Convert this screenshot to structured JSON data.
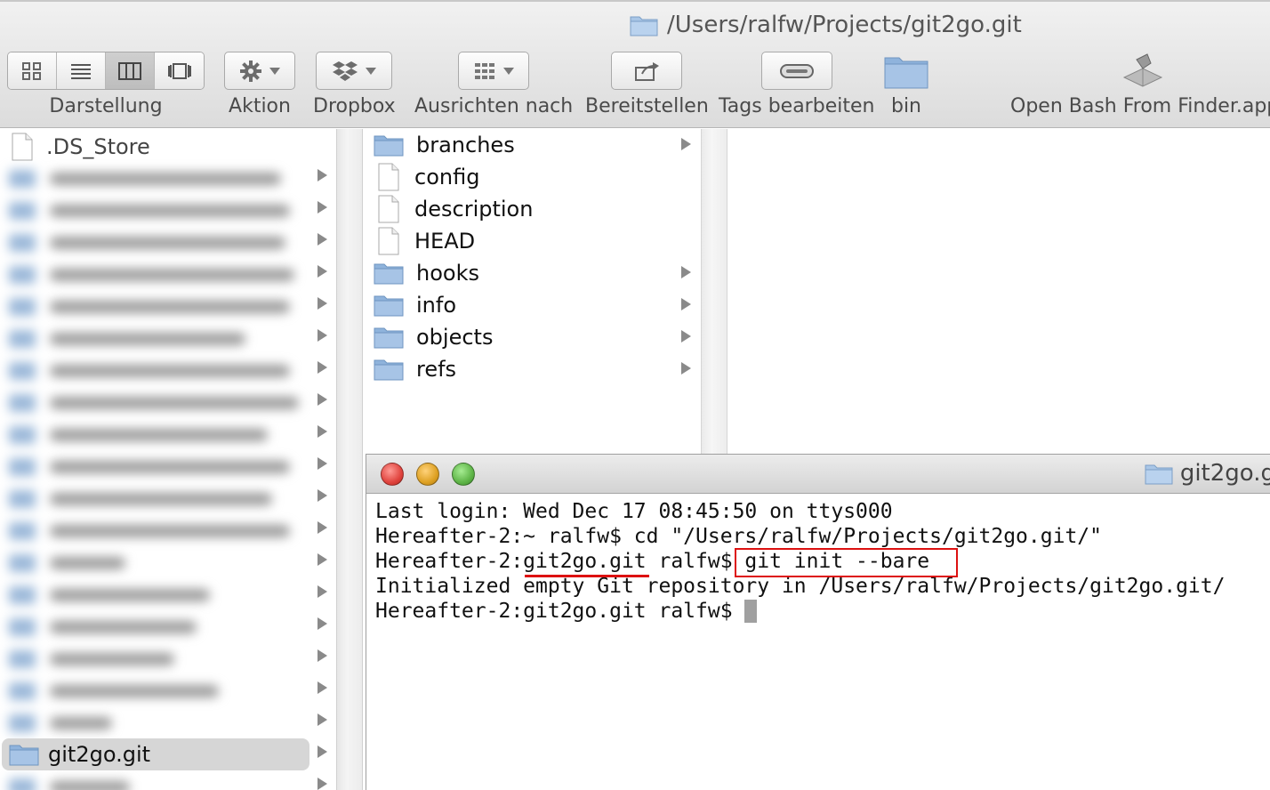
{
  "window": {
    "title": "/Users/ralfw/Projects/git2go.git"
  },
  "toolbar": {
    "items": [
      {
        "label": "Darstellung"
      },
      {
        "label": "Aktion"
      },
      {
        "label": "Dropbox"
      },
      {
        "label": "Ausrichten nach"
      },
      {
        "label": "Bereitstellen"
      },
      {
        "label": "Tags bearbeiten"
      },
      {
        "label": "bin"
      },
      {
        "label": "Open Bash From Finder.app"
      }
    ]
  },
  "column1": {
    "top_item": ".DS_Store",
    "selected_item": "git2go.git"
  },
  "column2": {
    "items": [
      {
        "name": "branches",
        "type": "folder"
      },
      {
        "name": "config",
        "type": "file"
      },
      {
        "name": "description",
        "type": "file"
      },
      {
        "name": "HEAD",
        "type": "file"
      },
      {
        "name": "hooks",
        "type": "folder"
      },
      {
        "name": "info",
        "type": "folder"
      },
      {
        "name": "objects",
        "type": "folder"
      },
      {
        "name": "refs",
        "type": "folder"
      }
    ]
  },
  "terminal": {
    "title": "git2go.g",
    "lines": [
      "Last login: Wed Dec 17 08:45:50 on ttys000",
      "Hereafter-2:~ ralfw$ cd \"/Users/ralfw/Projects/git2go.git/\"",
      "Hereafter-2:git2go.git ralfw$ git init --bare",
      "Initialized empty Git repository in /Users/ralfw/Projects/git2go.git/",
      "Hereafter-2:git2go.git ralfw$ "
    ]
  },
  "colors": {
    "folder": "#8fb3dc",
    "highlight": "#dd1111",
    "close": "#e0443e",
    "minimize": "#dea123",
    "zoom": "#5fb548"
  }
}
